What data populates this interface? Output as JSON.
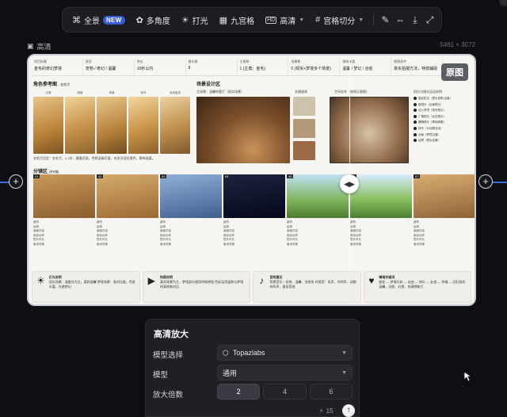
{
  "toolbar": {
    "panorama_label": "全景",
    "new_badge": "NEW",
    "multi_angle_label": "多角度",
    "lighting_label": "打光",
    "nine_grid_label": "九宫格",
    "hd_label": "高清",
    "grid_split_label": "宫格切分",
    "icons": [
      "panorama-icon",
      "multi-angle-icon",
      "lighting-icon",
      "nine-grid-icon",
      "hd-icon",
      "grid-split-icon",
      "brush-icon",
      "flip-icon",
      "download-icon",
      "expand-icon"
    ]
  },
  "image": {
    "label": "高清",
    "dimensions": "5461 × 3072",
    "original_badge": "原图"
  },
  "storyboard": {
    "info_headers": [
      "项目标题",
      "类型",
      "时长",
      "镜头数",
      "主角数",
      "场景数",
      "镜体体类",
      "期限条件"
    ],
    "info_values": [
      "金毛的奇幻梦境",
      "宠物 / 奇幻 / 温馨",
      "15秒以内",
      "8",
      "1 (主角：金毛)",
      "5 (现实+梦境多个场景)",
      "温馨 / 梦幻 / 治愈",
      "真实拍摄方法，特技辅助"
    ],
    "section_character": "角色参考图",
    "section_character_sub": "- 金毛犬",
    "character_captions": [
      "正面",
      "侧面",
      "背面",
      "特写",
      "自然姿态"
    ],
    "character_desc": "金毛犬设定：金毛犬，2-4岁，健康活泼，性格温顺可爱，毛发呈现金黄色，眼神温柔。",
    "section_scene": "场景设计区",
    "scene_main_caption": "主场景：温馨的客厅（现实场景）",
    "scene_props_caption": "关键道具",
    "scene_plan_caption": "空间关系（俯视示意图）",
    "scene_legend_caption": "机位与镜头运动说明",
    "legend_items": [
      "固定机位（镜头说明-近景）",
      "推镜头（近景镜头）",
      "切入梦境（特写镜头）",
      "广角镜头（太空镜头）",
      "跟随镜头（草地奔跑）",
      "特写（与动物互动）",
      "全景（梦境过渡）",
      "结尾（镜头定格）"
    ],
    "section_frames": "分镜区",
    "section_frames_sub": "(共8镜)",
    "frame_numbers": [
      "01",
      "02",
      "03",
      "04",
      "05",
      "06",
      "07"
    ],
    "frame_meta_labels": [
      "景别",
      "运镜",
      "画面内容",
      "角色动作",
      "镜头时长",
      "景深效果"
    ],
    "bottom_cards": [
      {
        "title": "灯光说明",
        "text": "现实场景：温暖光为主，柔和温馨 梦境场景：高对比度，色彩丰富，光感梦幻"
      },
      {
        "title": "构图说明",
        "text": "真实场景为主，梦境部分使用特效增强 色彩运用温和与梦境的高饱和对比"
      },
      {
        "title": "音效建议",
        "text": "背景音乐：轻快、温馨、治愈系 环境音：风声、鸟鸣声、动物的叫声、星辰音效"
      },
      {
        "title": "情绪关键词",
        "text": "放松 — 梦境开启 — 自由 — 快乐 — 友谊 — 幸福 — 回归现实 温馨、治愈、幻想、充满想象力"
      }
    ]
  },
  "panel": {
    "title": "高清放大",
    "model_select_label": "模型选择",
    "model_select_value": "Topazlabs",
    "model_label": "模型",
    "model_value": "通用",
    "scale_label": "放大倍数",
    "scale_options": [
      "2",
      "4",
      "6"
    ],
    "scale_selected": "2",
    "credits": "15"
  },
  "colors": {
    "accent_blue": "#3b6fe0",
    "new_badge": "#3a5bd6",
    "panel_bg": "#1f2026"
  }
}
